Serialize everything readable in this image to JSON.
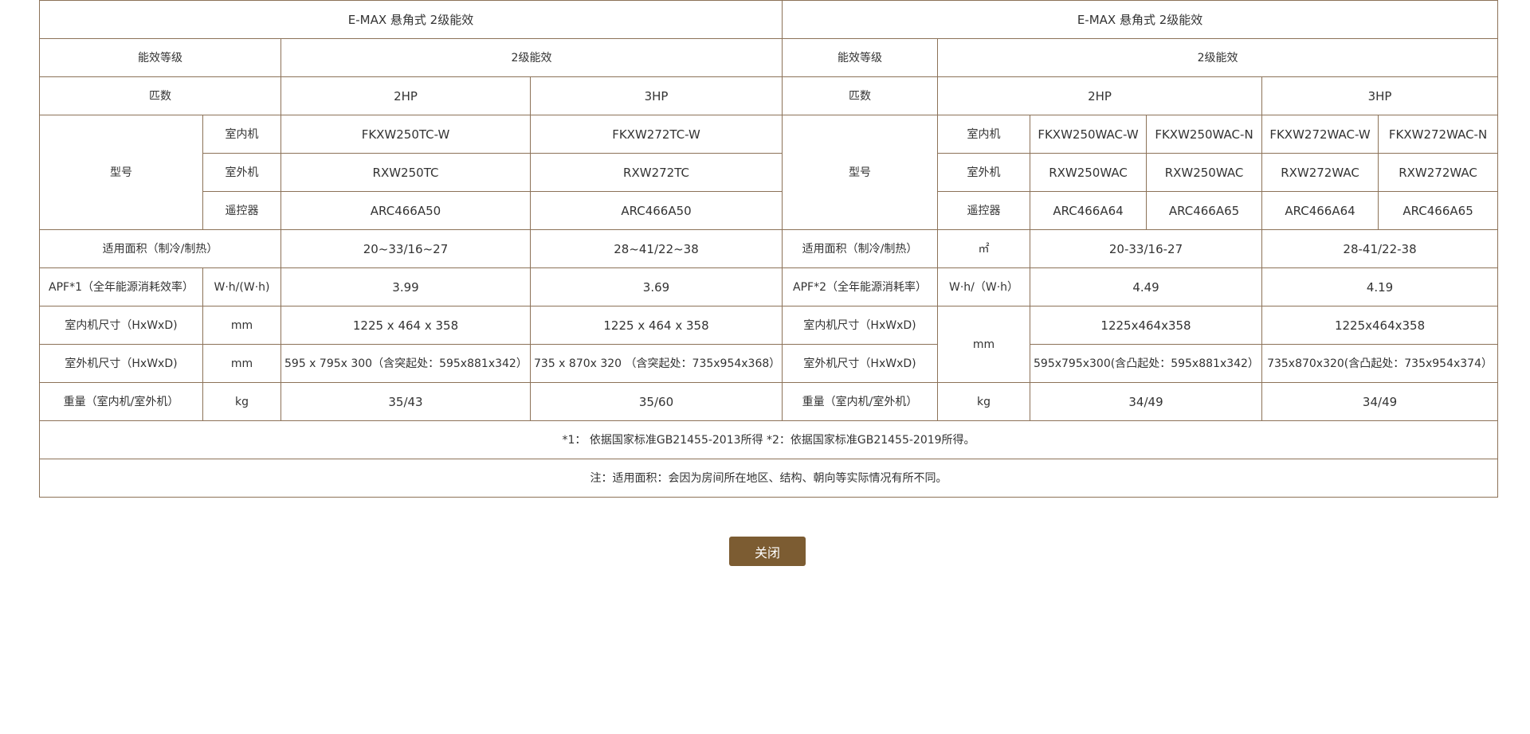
{
  "left": {
    "title": "E-MAX 悬角式 2级能效",
    "efficiency_label": "能效等级",
    "efficiency_value": "2级能效",
    "hp_label": "匹数",
    "hp": [
      "2HP",
      "3HP"
    ],
    "model_label": "型号",
    "indoor_label": "室内机",
    "outdoor_label": "室外机",
    "remote_label": "遥控器",
    "indoor": [
      "FKXW250TC-W",
      "FKXW272TC-W"
    ],
    "outdoor": [
      "RXW250TC",
      "RXW272TC"
    ],
    "remote": [
      "ARC466A50",
      "ARC466A50"
    ],
    "area_label": "适用面积（制冷/制热）",
    "area": [
      "20~33/16~27",
      "28~41/22~38"
    ],
    "apf_label": "APF*1（全年能源消耗效率）",
    "apf_unit": "W·h/(W·h)",
    "apf": [
      "3.99",
      "3.69"
    ],
    "indoor_size_label": "室内机尺寸（HxWxD)",
    "indoor_size_unit": "mm",
    "indoor_size": [
      "1225 x 464 x 358",
      "1225 x 464 x 358"
    ],
    "outdoor_size_label": "室外机尺寸（HxWxD)",
    "outdoor_size_unit": "mm",
    "outdoor_size": [
      "595 x 795x 300（含突起处：595x881x342）",
      "735 x 870x 320 （含突起处：735x954x368）"
    ],
    "weight_label": "重量（室内机/室外机）",
    "weight_unit": "kg",
    "weight": [
      "35/43",
      "35/60"
    ]
  },
  "right": {
    "title": "E-MAX 悬角式 2级能效",
    "efficiency_label": "能效等级",
    "efficiency_value": "2级能效",
    "hp_label": "匹数",
    "hp": [
      "2HP",
      "3HP"
    ],
    "model_label": "型号",
    "indoor_label": "室内机",
    "outdoor_label": "室外机",
    "remote_label": "遥控器",
    "indoor": [
      "FKXW250WAC-W",
      "FKXW250WAC-N",
      "FKXW272WAC-W",
      "FKXW272WAC-N"
    ],
    "outdoor": [
      "RXW250WAC",
      "RXW250WAC",
      "RXW272WAC",
      "RXW272WAC"
    ],
    "remote": [
      "ARC466A64",
      "ARC466A65",
      "ARC466A64",
      "ARC466A65"
    ],
    "area_label": "适用面积（制冷/制热）",
    "area_unit": "㎡",
    "area": [
      "20-33/16-27",
      "28-41/22-38"
    ],
    "apf_label": "APF*2（全年能源消耗率）",
    "apf_unit": "W·h/（W·h）",
    "apf": [
      "4.49",
      "4.19"
    ],
    "indoor_size_label": "室内机尺寸（HxWxD)",
    "size_unit": "mm",
    "indoor_size": [
      "1225x464x358",
      "1225x464x358"
    ],
    "outdoor_size_label": "室外机尺寸（HxWxD)",
    "outdoor_size": [
      "595x795x300(含凸起处：595x881x342）",
      "735x870x320(含凸起处：735x954x374）"
    ],
    "weight_label": "重量（室内机/室外机）",
    "weight_unit": "kg",
    "weight": [
      "34/49",
      "34/49"
    ]
  },
  "footnote": "*1： 依据国家标准GB21455-2013所得 *2：依据国家标准GB21455-2019所得。",
  "note": "注：适用面积：会因为房间所在地区、结构、朝向等实际情况有所不同。",
  "close_label": "关闭",
  "colors": {
    "border": "#8c7258",
    "button": "#7c5c32",
    "text": "#333333"
  }
}
